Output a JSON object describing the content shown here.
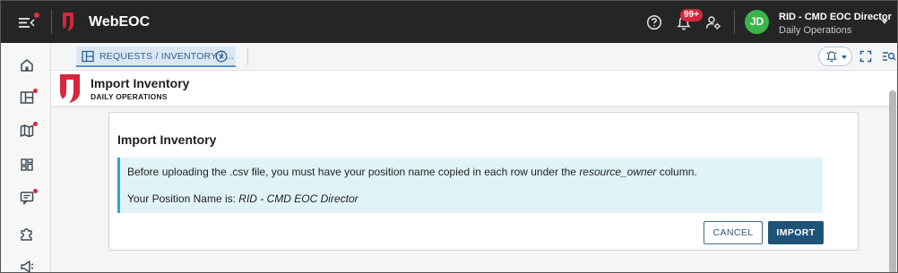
{
  "app": {
    "title": "WebEOC"
  },
  "topbar": {
    "notification_badge": "99+",
    "user": {
      "initials": "JD",
      "position": "RID - CMD EOC Director",
      "incident": "Daily Operations"
    }
  },
  "tabs": [
    {
      "label": "REQUESTS / INVENTORY / ..."
    }
  ],
  "page": {
    "title": "Import Inventory",
    "subtitle": "DAILY OPERATIONS"
  },
  "dialog": {
    "title": "Import Inventory",
    "info": {
      "line1_prefix": "Before uploading the .csv file, you must have your position name copied in each row under the ",
      "line1_emphasis": "resource_owner",
      "line1_suffix": " column.",
      "line2_prefix": "Your Position Name is: ",
      "line2_emphasis": "RID - CMD EOC Director"
    },
    "cancel_label": "CANCEL",
    "import_label": "IMPORT"
  },
  "colors": {
    "topbar_bg": "#252526",
    "brand_red": "#d7263d",
    "avatar_green": "#39b54a",
    "info_bg": "#e0f3f8",
    "info_accent": "#2aa9c8",
    "primary_button": "#1f5478"
  },
  "icons": {
    "menu": "menu-collapse-icon",
    "help": "help-circle-icon",
    "notifications": "bell-icon",
    "user_settings": "user-gear-icon",
    "sidebar": [
      "home-icon",
      "board-icon",
      "map-icon",
      "dashboard-icon",
      "chat-icon",
      "plugin-icon",
      "megaphone-icon"
    ],
    "tab": "split-view-icon",
    "tab_close": "close-circle-icon",
    "alerts": "alarm-bell-icon",
    "expand": "fullscreen-icon",
    "search": "list-search-icon"
  }
}
